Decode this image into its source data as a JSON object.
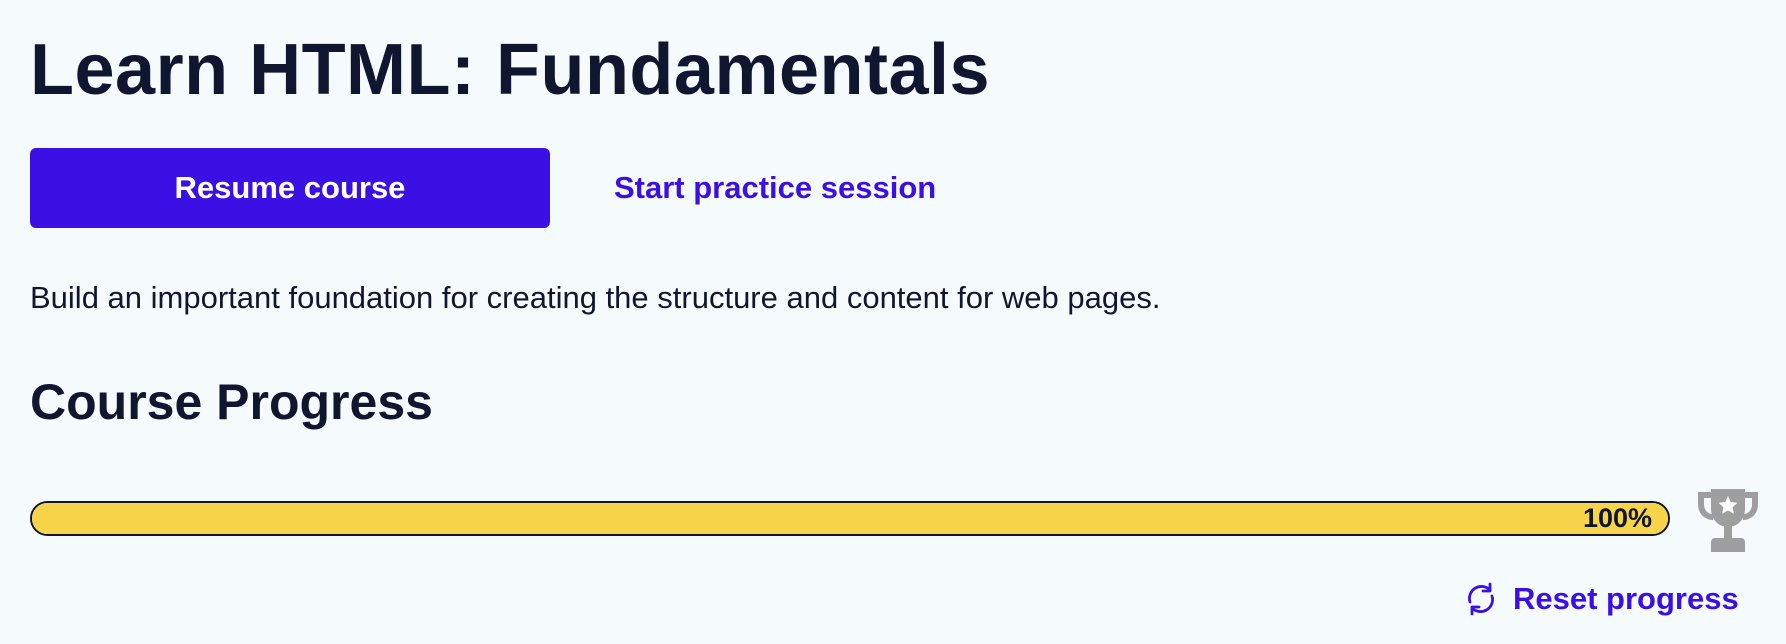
{
  "course": {
    "title": "Learn HTML: Fundamentals",
    "resume_label": "Resume course",
    "practice_label": "Start practice session",
    "description": "Build an important foundation for creating the structure and content for web pages."
  },
  "progress": {
    "heading": "Course Progress",
    "percent": 100,
    "percent_label": "100%",
    "trophy_icon": "trophy-icon",
    "reset_label": "Reset progress",
    "reset_icon": "refresh-icon"
  },
  "colors": {
    "background": "#f5fafd",
    "text": "#10162f",
    "accent": "#3a10e5",
    "progress_fill": "#f8d44a",
    "trophy": "#9e9e9e"
  }
}
